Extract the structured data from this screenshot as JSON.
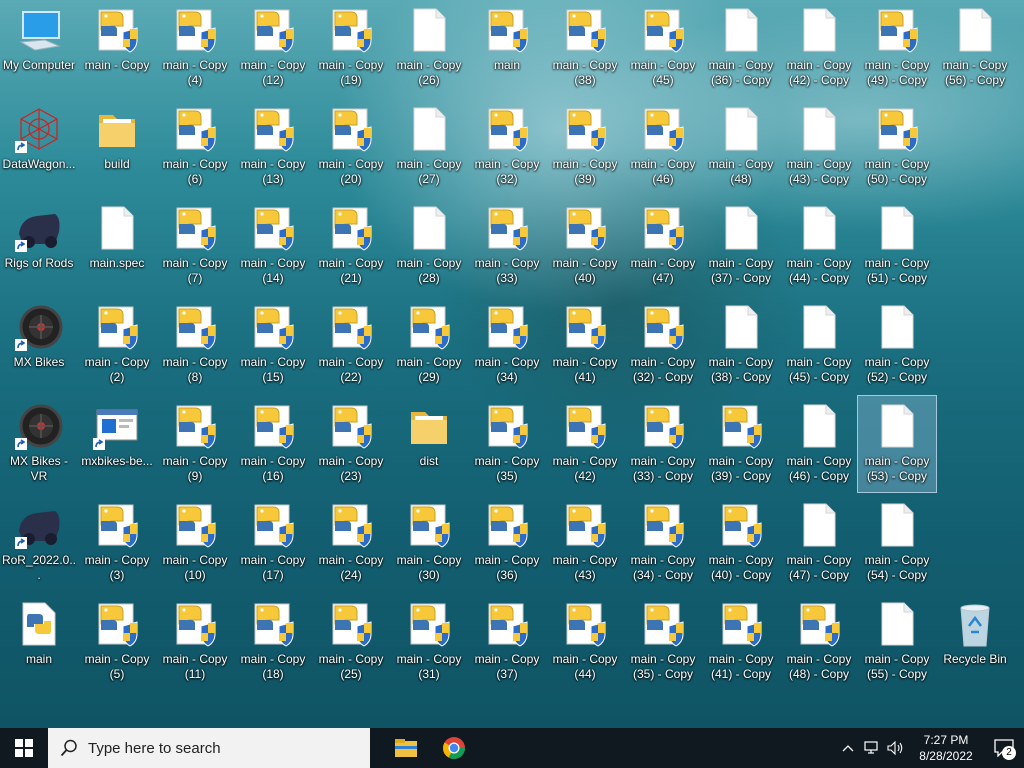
{
  "desktop": {
    "columns": [
      [
        {
          "label": "My Computer",
          "icon": "computer-icon"
        },
        {
          "label": "DataWagon...",
          "icon": "datawagon-icon",
          "shortcut": true
        },
        {
          "label": "Rigs of Rods",
          "icon": "rigs-of-rods-icon",
          "shortcut": true
        },
        {
          "label": "MX Bikes",
          "icon": "mx-bikes-icon",
          "shortcut": true
        },
        {
          "label": "MX Bikes - VR",
          "icon": "mx-bikes-icon",
          "shortcut": true
        },
        {
          "label": "RoR_2022.0...",
          "icon": "rigs-of-rods-icon",
          "shortcut": true
        },
        {
          "label": "main",
          "icon": "python-file-icon"
        }
      ],
      [
        {
          "label": "main - Copy",
          "icon": "python-exe-icon"
        },
        {
          "label": "build",
          "icon": "folder-icon"
        },
        {
          "label": "main.spec",
          "icon": "blank-file-icon"
        },
        {
          "label": "main - Copy\n(2)",
          "icon": "python-exe-icon"
        },
        {
          "label": "mxbikes-be...",
          "icon": "app-window-icon",
          "shortcut": true
        },
        {
          "label": "main - Copy\n(3)",
          "icon": "python-exe-icon"
        },
        {
          "label": "main - Copy\n(5)",
          "icon": "python-exe-icon"
        }
      ],
      [
        {
          "label": "main - Copy\n(4)",
          "icon": "python-exe-icon"
        },
        {
          "label": "main - Copy\n(6)",
          "icon": "python-exe-icon"
        },
        {
          "label": "main - Copy\n(7)",
          "icon": "python-exe-icon"
        },
        {
          "label": "main - Copy\n(8)",
          "icon": "python-exe-icon"
        },
        {
          "label": "main - Copy\n(9)",
          "icon": "python-exe-icon"
        },
        {
          "label": "main - Copy\n(10)",
          "icon": "python-exe-icon"
        },
        {
          "label": "main - Copy\n(11)",
          "icon": "python-exe-icon"
        }
      ],
      [
        {
          "label": "main - Copy\n(12)",
          "icon": "python-exe-icon"
        },
        {
          "label": "main - Copy\n(13)",
          "icon": "python-exe-icon"
        },
        {
          "label": "main - Copy\n(14)",
          "icon": "python-exe-icon"
        },
        {
          "label": "main - Copy\n(15)",
          "icon": "python-exe-icon"
        },
        {
          "label": "main - Copy\n(16)",
          "icon": "python-exe-icon"
        },
        {
          "label": "main - Copy\n(17)",
          "icon": "python-exe-icon"
        },
        {
          "label": "main - Copy\n(18)",
          "icon": "python-exe-icon"
        }
      ],
      [
        {
          "label": "main - Copy\n(19)",
          "icon": "python-exe-icon"
        },
        {
          "label": "main - Copy\n(20)",
          "icon": "python-exe-icon"
        },
        {
          "label": "main - Copy\n(21)",
          "icon": "python-exe-icon"
        },
        {
          "label": "main - Copy\n(22)",
          "icon": "python-exe-icon"
        },
        {
          "label": "main - Copy\n(23)",
          "icon": "python-exe-icon"
        },
        {
          "label": "main - Copy\n(24)",
          "icon": "python-exe-icon"
        },
        {
          "label": "main - Copy\n(25)",
          "icon": "python-exe-icon"
        }
      ],
      [
        {
          "label": "main - Copy\n(26)",
          "icon": "blank-file-icon"
        },
        {
          "label": "main - Copy\n(27)",
          "icon": "blank-file-icon"
        },
        {
          "label": "main - Copy\n(28)",
          "icon": "blank-file-icon"
        },
        {
          "label": "main - Copy\n(29)",
          "icon": "python-exe-icon"
        },
        {
          "label": "dist",
          "icon": "folder-icon"
        },
        {
          "label": "main - Copy\n(30)",
          "icon": "python-exe-icon"
        },
        {
          "label": "main - Copy\n(31)",
          "icon": "python-exe-icon"
        }
      ],
      [
        {
          "label": "main",
          "icon": "python-exe-icon"
        },
        {
          "label": "main - Copy\n(32)",
          "icon": "python-exe-icon"
        },
        {
          "label": "main - Copy\n(33)",
          "icon": "python-exe-icon"
        },
        {
          "label": "main - Copy\n(34)",
          "icon": "python-exe-icon"
        },
        {
          "label": "main - Copy\n(35)",
          "icon": "python-exe-icon"
        },
        {
          "label": "main - Copy\n(36)",
          "icon": "python-exe-icon"
        },
        {
          "label": "main - Copy\n(37)",
          "icon": "python-exe-icon"
        }
      ],
      [
        {
          "label": "main - Copy\n(38)",
          "icon": "python-exe-icon"
        },
        {
          "label": "main - Copy\n(39)",
          "icon": "python-exe-icon"
        },
        {
          "label": "main - Copy\n(40)",
          "icon": "python-exe-icon"
        },
        {
          "label": "main - Copy\n(41)",
          "icon": "python-exe-icon"
        },
        {
          "label": "main - Copy\n(42)",
          "icon": "python-exe-icon"
        },
        {
          "label": "main - Copy\n(43)",
          "icon": "python-exe-icon"
        },
        {
          "label": "main - Copy\n(44)",
          "icon": "python-exe-icon"
        }
      ],
      [
        {
          "label": "main - Copy\n(45)",
          "icon": "python-exe-icon"
        },
        {
          "label": "main - Copy\n(46)",
          "icon": "python-exe-icon"
        },
        {
          "label": "main - Copy\n(47)",
          "icon": "python-exe-icon"
        },
        {
          "label": "main - Copy\n(32) - Copy",
          "icon": "python-exe-icon"
        },
        {
          "label": "main - Copy\n(33) - Copy",
          "icon": "python-exe-icon"
        },
        {
          "label": "main - Copy\n(34) - Copy",
          "icon": "python-exe-icon"
        },
        {
          "label": "main - Copy\n(35) - Copy",
          "icon": "python-exe-icon"
        }
      ],
      [
        {
          "label": "main - Copy\n(36) - Copy",
          "icon": "blank-file-icon"
        },
        {
          "label": "main - Copy\n(48)",
          "icon": "blank-file-icon"
        },
        {
          "label": "main - Copy\n(37) - Copy",
          "icon": "blank-file-icon"
        },
        {
          "label": "main - Copy\n(38) - Copy",
          "icon": "blank-file-icon"
        },
        {
          "label": "main - Copy\n(39) - Copy",
          "icon": "python-exe-icon"
        },
        {
          "label": "main - Copy\n(40) - Copy",
          "icon": "python-exe-icon"
        },
        {
          "label": "main - Copy\n(41) - Copy",
          "icon": "python-exe-icon"
        }
      ],
      [
        {
          "label": "main - Copy\n(42) - Copy",
          "icon": "blank-file-icon"
        },
        {
          "label": "main - Copy\n(43) - Copy",
          "icon": "blank-file-icon"
        },
        {
          "label": "main - Copy\n(44) - Copy",
          "icon": "blank-file-icon"
        },
        {
          "label": "main - Copy\n(45) - Copy",
          "icon": "blank-file-icon"
        },
        {
          "label": "main - Copy\n(46) - Copy",
          "icon": "blank-file-icon"
        },
        {
          "label": "main - Copy\n(47) - Copy",
          "icon": "blank-file-icon"
        },
        {
          "label": "main - Copy\n(48) - Copy",
          "icon": "python-exe-icon"
        }
      ],
      [
        {
          "label": "main - Copy\n(49) - Copy",
          "icon": "python-exe-icon"
        },
        {
          "label": "main - Copy\n(50) - Copy",
          "icon": "python-exe-icon"
        },
        {
          "label": "main - Copy\n(51) - Copy",
          "icon": "blank-file-icon"
        },
        {
          "label": "main - Copy\n(52) - Copy",
          "icon": "blank-file-icon"
        },
        {
          "label": "main - Copy\n(53) - Copy",
          "icon": "blank-file-icon",
          "selected": true
        },
        {
          "label": "main - Copy\n(54) - Copy",
          "icon": "blank-file-icon"
        },
        {
          "label": "main - Copy\n(55) - Copy",
          "icon": "blank-file-icon"
        }
      ],
      [
        {
          "label": "main - Copy\n(56) - Copy",
          "icon": "blank-file-icon"
        },
        null,
        null,
        null,
        null,
        null,
        {
          "label": "Recycle Bin",
          "icon": "recycle-bin-icon"
        }
      ]
    ]
  },
  "taskbar": {
    "start_icon": "windows-start-icon",
    "search_placeholder": "Type here to search",
    "pinned": [
      {
        "name": "file-explorer",
        "icon": "file-explorer-icon"
      },
      {
        "name": "chrome",
        "icon": "chrome-icon"
      }
    ],
    "clock_time": "7:27 PM",
    "clock_date": "8/28/2022",
    "notification_count": "2"
  },
  "colors": {
    "taskbar_bg": "#101820",
    "search_bg": "#f2f2f2",
    "accent_blue": "#2a6cc7",
    "python_yellow": "#f6c83a"
  }
}
